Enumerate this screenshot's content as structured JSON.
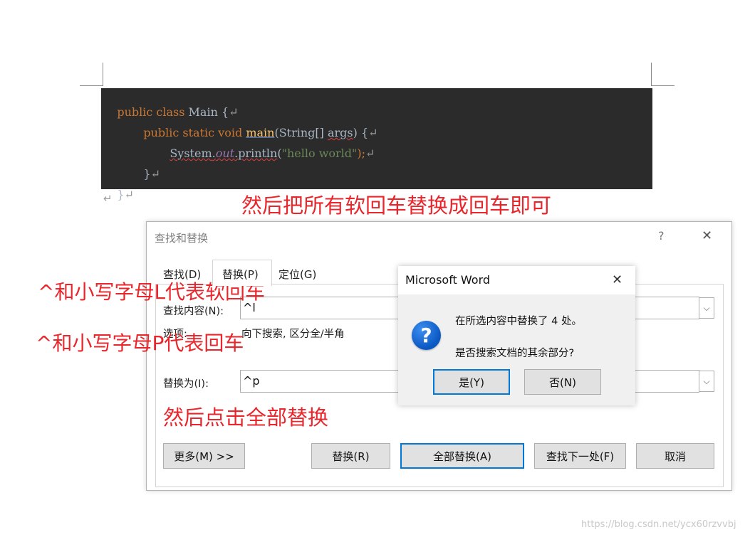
{
  "code": {
    "line1": {
      "kw": "public class ",
      "name": "Main",
      "brace": " {",
      "mark": "↵"
    },
    "line2": {
      "kw": "public static void ",
      "method": "main",
      "paren": "(",
      "type": "String[] ",
      "args": "args",
      "close": ") {",
      "mark": "↵"
    },
    "line3": {
      "sys": "System",
      "dot1": ".",
      "out": "out",
      "dot2": ".",
      "call": "println",
      "open": "(",
      "str": "\"hello world\"",
      "end": ");",
      "mark": "↵"
    },
    "line4": {
      "brace": "}",
      "mark": "↵"
    },
    "line5": {
      "brace": "}",
      "mark": "↵"
    },
    "para_mark": "↵"
  },
  "annotations": {
    "top": "然后把所有软回车替换成回车即可",
    "soft": "^和小写字母L代表软回车",
    "hard": "^和小写字母P代表回车",
    "click": "然后点击全部替换"
  },
  "find_replace": {
    "title": "查找和替换",
    "help": "?",
    "close": "✕",
    "tabs": [
      "查找(D)",
      "替换(P)",
      "定位(G)"
    ],
    "find_label": "查找内容(N):",
    "find_value": "^l",
    "options_label": "选项:",
    "options_value": "向下搜索, 区分全/半角",
    "replace_label": "替换为(I):",
    "replace_value": "^p",
    "buttons": {
      "more": "更多(M) >>",
      "replace": "替换(R)",
      "replace_all": "全部替换(A)",
      "find_next": "查找下一处(F)",
      "cancel": "取消"
    }
  },
  "message_box": {
    "title": "Microsoft Word",
    "close": "✕",
    "icon": "question-icon",
    "icon_glyph": "?",
    "line1": "在所选内容中替换了 4 处。",
    "line2": "是否搜索文档的其余部分?",
    "yes": "是(Y)",
    "no": "否(N)"
  },
  "watermark": "https://blog.csdn.net/ycx60rzvvbj"
}
